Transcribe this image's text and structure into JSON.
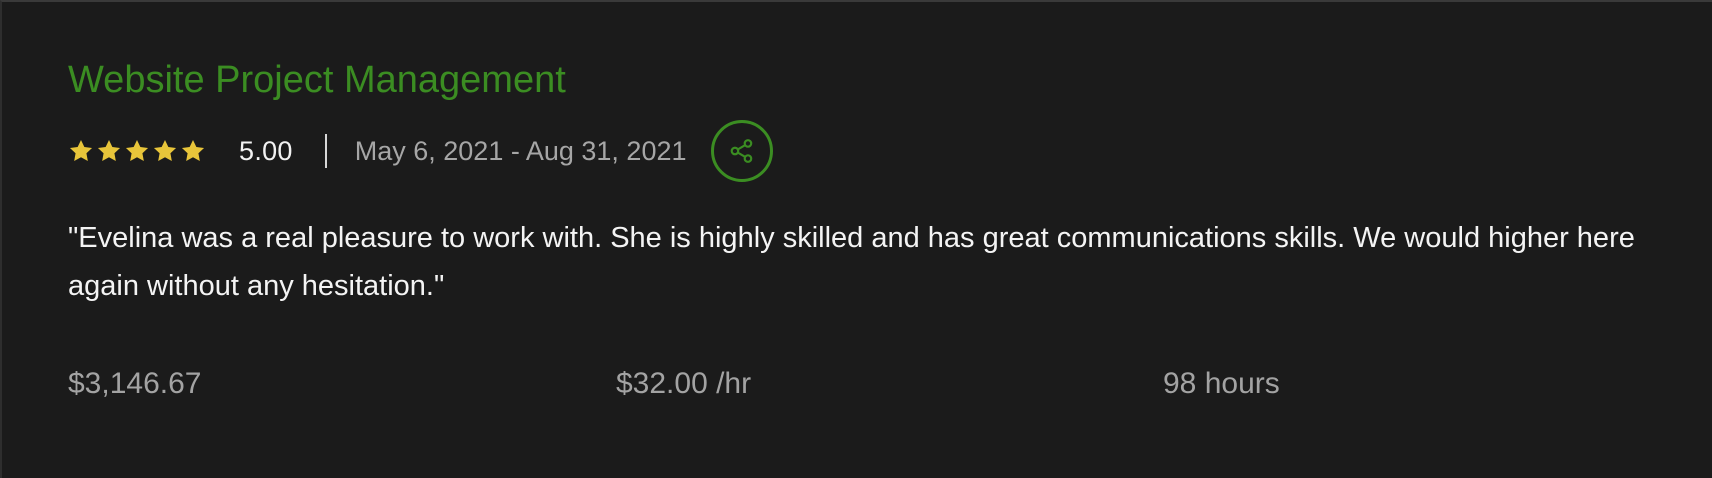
{
  "colors": {
    "background": "#1b1b1b",
    "title_green": "#3b8d22",
    "star_yellow": "#e8c53a",
    "muted_text": "#a6a6a6",
    "body_text": "#f4f4f4"
  },
  "review": {
    "title": "Website Project Management",
    "stars_filled": 5,
    "stars_total": 5,
    "rating": "5.00",
    "date_range": "May 6, 2021 - Aug 31, 2021",
    "share_icon": "share-icon",
    "quote": "\"Evelina was a real pleasure to work with. She is highly skilled and has great communications skills. We would higher here again without any hesitation.\"",
    "total_earned": "$3,146.67",
    "hourly_rate": "$32.00 /hr",
    "hours": "98 hours"
  }
}
